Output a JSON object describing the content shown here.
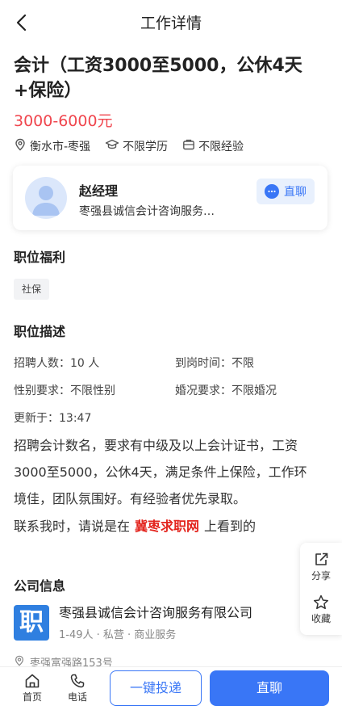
{
  "header": {
    "title": "工作详情"
  },
  "job": {
    "title": "会计（工资3000至5000，公休4天+保险）",
    "salary": "3000-6000元",
    "location": "衡水市-枣强",
    "education": "不限学历",
    "experience": "不限经验"
  },
  "recruiter": {
    "name": "赵经理",
    "company": "枣强县诚信会计咨询服务…",
    "chat_label": "直聊"
  },
  "benefits": {
    "title": "职位福利",
    "tags": [
      "社保"
    ]
  },
  "description": {
    "title": "职位描述",
    "headcount_label": "招聘人数：",
    "headcount_value": "10 人",
    "arrival_label": "到岗时间：",
    "arrival_value": "不限",
    "gender_label": "性别要求：",
    "gender_value": "不限性别",
    "marital_label": "婚况要求：",
    "marital_value": "不限婚况",
    "updated_label": "更新于：",
    "updated_value": "13:47",
    "text": "招聘会计数名，要求有中级及以上会计证书，工资3000至5000，公休4天，满足条件上保险，工作环境佳，团队氛围好。有经验者优先录取。",
    "contact_prefix": "联系我时，请说是在",
    "contact_brand": "冀枣求职网",
    "contact_suffix": "上看到的"
  },
  "float_actions": {
    "share": "分享",
    "favorite": "收藏"
  },
  "company": {
    "title": "公司信息",
    "logo_char": "职",
    "name": "枣强县诚信会计咨询服务有限公司",
    "info": "1-49人 · 私营 · 商业服务",
    "address": "枣强富强路153号"
  },
  "bottom": {
    "home": "首页",
    "phone": "电话",
    "apply": "一键投递",
    "chat": "直聊"
  },
  "colors": {
    "accent": "#3976f6",
    "salary": "#f0464e",
    "brand": "#e3241d"
  }
}
